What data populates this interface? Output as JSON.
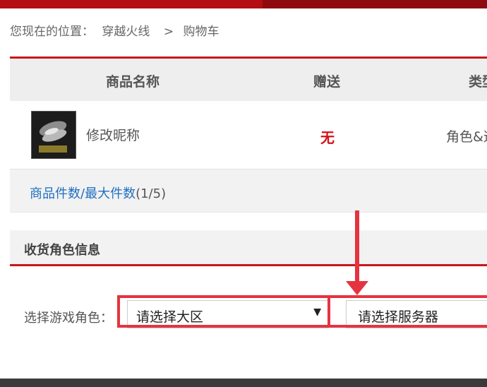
{
  "breadcrumb": {
    "prefix": "您现在的位置：",
    "item1": "穿越火线",
    "separator": ">",
    "item2": "购物车"
  },
  "table": {
    "headers": [
      "商品名称",
      "赠送",
      "类型"
    ],
    "rows": [
      {
        "name": "修改昵称",
        "gift": "无",
        "type": "角色&道"
      }
    ],
    "count": {
      "label": "商品件数/最大件数",
      "value": "(1/5)"
    }
  },
  "section": {
    "title": "收货角色信息"
  },
  "form": {
    "role_label": "选择游戏角色：",
    "region_select": {
      "selected": "请选择大区",
      "arrow": "▼"
    },
    "server_select": {
      "selected": "请选择服务器"
    }
  },
  "colors": {
    "accent_red": "#c8161d",
    "annotation_red": "#e53340",
    "link_blue": "#1f6fbf"
  }
}
